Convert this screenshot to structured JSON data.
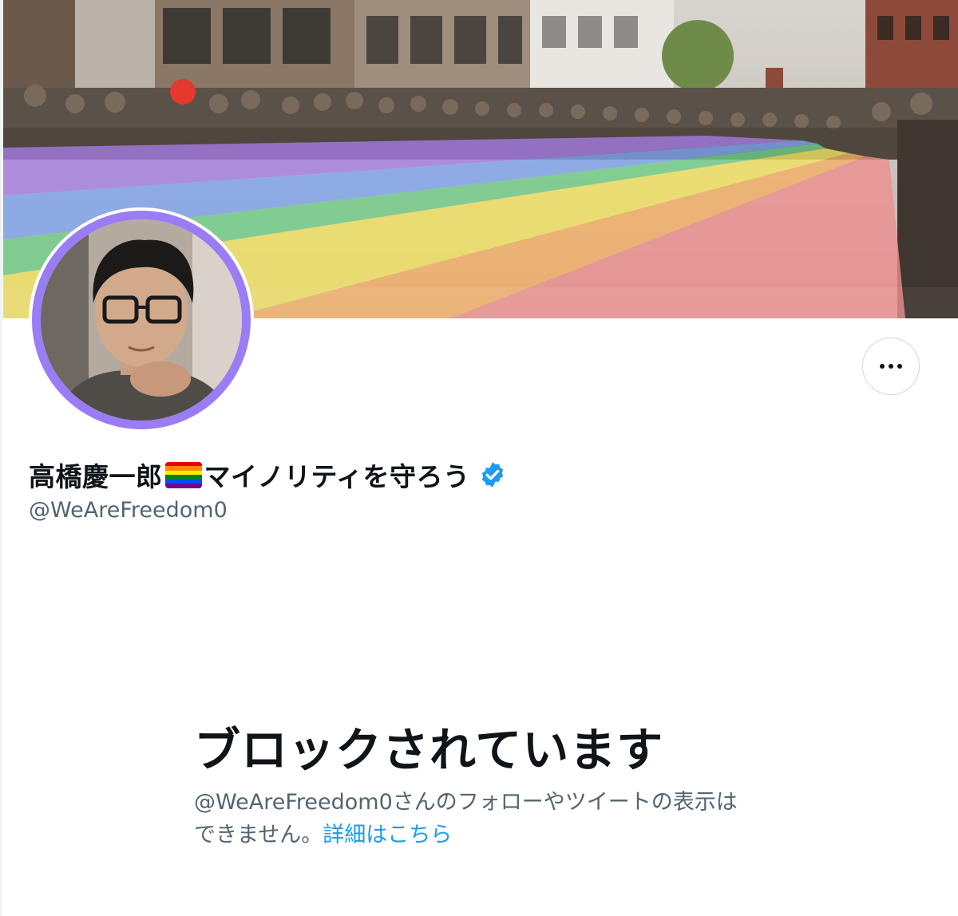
{
  "profile": {
    "name_part1": "高橋慶一郎",
    "name_part2": "マイノリティを守ろう",
    "handle": "@WeAreFreedom0",
    "flag_icon": "rainbow-flag-icon",
    "verified_icon": "verified-badge-icon"
  },
  "actions": {
    "more_icon": "more-horizontal-icon"
  },
  "blocked": {
    "title": "ブロックされています",
    "desc_line1": "@WeAreFreedom0さんのフォローやツイートの表示は",
    "desc_line2": "できません。",
    "learn_more": "詳細はこちら"
  },
  "colors": {
    "text_primary": "#0f1419",
    "text_secondary": "#536471",
    "link": "#1d9bf0",
    "verified": "#1d9bf0",
    "avatar_ring": "#9a7cf4",
    "rainbow": [
      "#e40303",
      "#ff8c00",
      "#ffed00",
      "#008026",
      "#004dff",
      "#750787"
    ]
  }
}
